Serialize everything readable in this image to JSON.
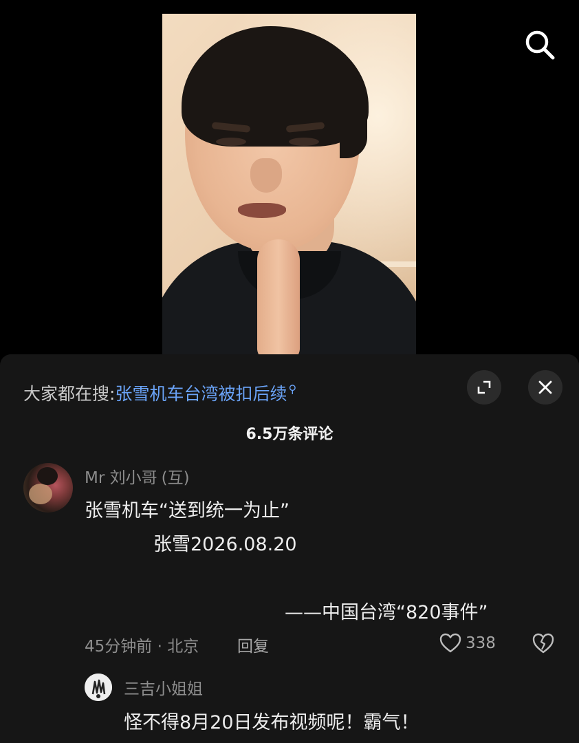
{
  "search": {
    "prefix": "大家都在搜:",
    "term": "张雪机车台湾被扣后续"
  },
  "comments_count": "6.5万条评论",
  "comments": [
    {
      "username": "Mr 刘小哥",
      "relation": "(互)",
      "lines": [
        "张雪机车“送到统一为止”",
        "张雪2026.08.20",
        "——中国台湾“820事件”"
      ],
      "time_location": "45分钟前 · 北京",
      "reply_label": "回复",
      "likes": "338"
    }
  ],
  "reply": {
    "username": "三吉小姐姐",
    "text": "怪不得8月20日发布视频呢！霸气！"
  },
  "colors": {
    "link_blue": "#6aa3f7",
    "sheet_bg": "#161616",
    "muted_text": "#8d8d8d"
  },
  "icons": {
    "search": "search-icon",
    "expand": "expand-icon",
    "close": "close-icon",
    "like": "heart-icon",
    "dislike": "broken-heart-icon"
  }
}
